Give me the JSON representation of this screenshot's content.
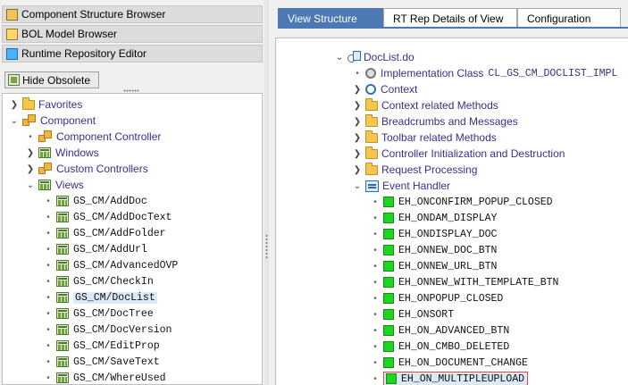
{
  "nav": {
    "component_structure_browser": "Component Structure Browser",
    "bol_model_browser": "BOL Model Browser",
    "runtime_repository_editor": "Runtime Repository Editor",
    "hide_obsolete": "Hide Obsolete"
  },
  "left_tree": {
    "favorites": "Favorites",
    "component": "Component",
    "component_controller": "Component Controller",
    "windows": "Windows",
    "custom_controllers": "Custom Controllers",
    "views": "Views",
    "view_items": [
      "GS_CM/AddDoc",
      "GS_CM/AddDocText",
      "GS_CM/AddFolder",
      "GS_CM/AddUrl",
      "GS_CM/AdvancedOVP",
      "GS_CM/CheckIn",
      "GS_CM/DocList",
      "GS_CM/DocTree",
      "GS_CM/DocVersion",
      "GS_CM/EditProp",
      "GS_CM/SaveText",
      "GS_CM/WhereUsed"
    ],
    "selected_index": 6
  },
  "tabs": [
    "View Structure",
    "RT Rep Details of View",
    "Configuration"
  ],
  "right_tree": {
    "root": "DocList.do",
    "impl_class_label": "Implementation Class",
    "impl_class_value": "CL_GS_CM_DOCLIST_IMPL",
    "context": "Context",
    "folders": [
      "Context related Methods",
      "Breadcrumbs and Messages",
      "Toolbar related Methods",
      "Controller Initialization and Destruction",
      "Request Processing"
    ],
    "event_handler": "Event Handler",
    "handlers": [
      "EH_ONCONFIRM_POPUP_CLOSED",
      "EH_ONDAM_DISPLAY",
      "EH_ONDISPLAY_DOC",
      "EH_ONNEW_DOC_BTN",
      "EH_ONNEW_URL_BTN",
      "EH_ONNEW_WITH_TEMPLATE_BTN",
      "EH_ONPOPUP_CLOSED",
      "EH_ONSORT",
      "EH_ON_ADVANCED_BTN",
      "EH_ON_CMBO_DELETED",
      "EH_ON_DOCUMENT_CHANGE",
      "EH_ON_MULTIPLEUPLOAD"
    ],
    "selected_handler_index": 11
  },
  "colors": {
    "tab_active": "#4c79b3",
    "selection": "#dbe8f5",
    "selection_border": "#e04848",
    "handler_icon": "#1fd61f"
  }
}
